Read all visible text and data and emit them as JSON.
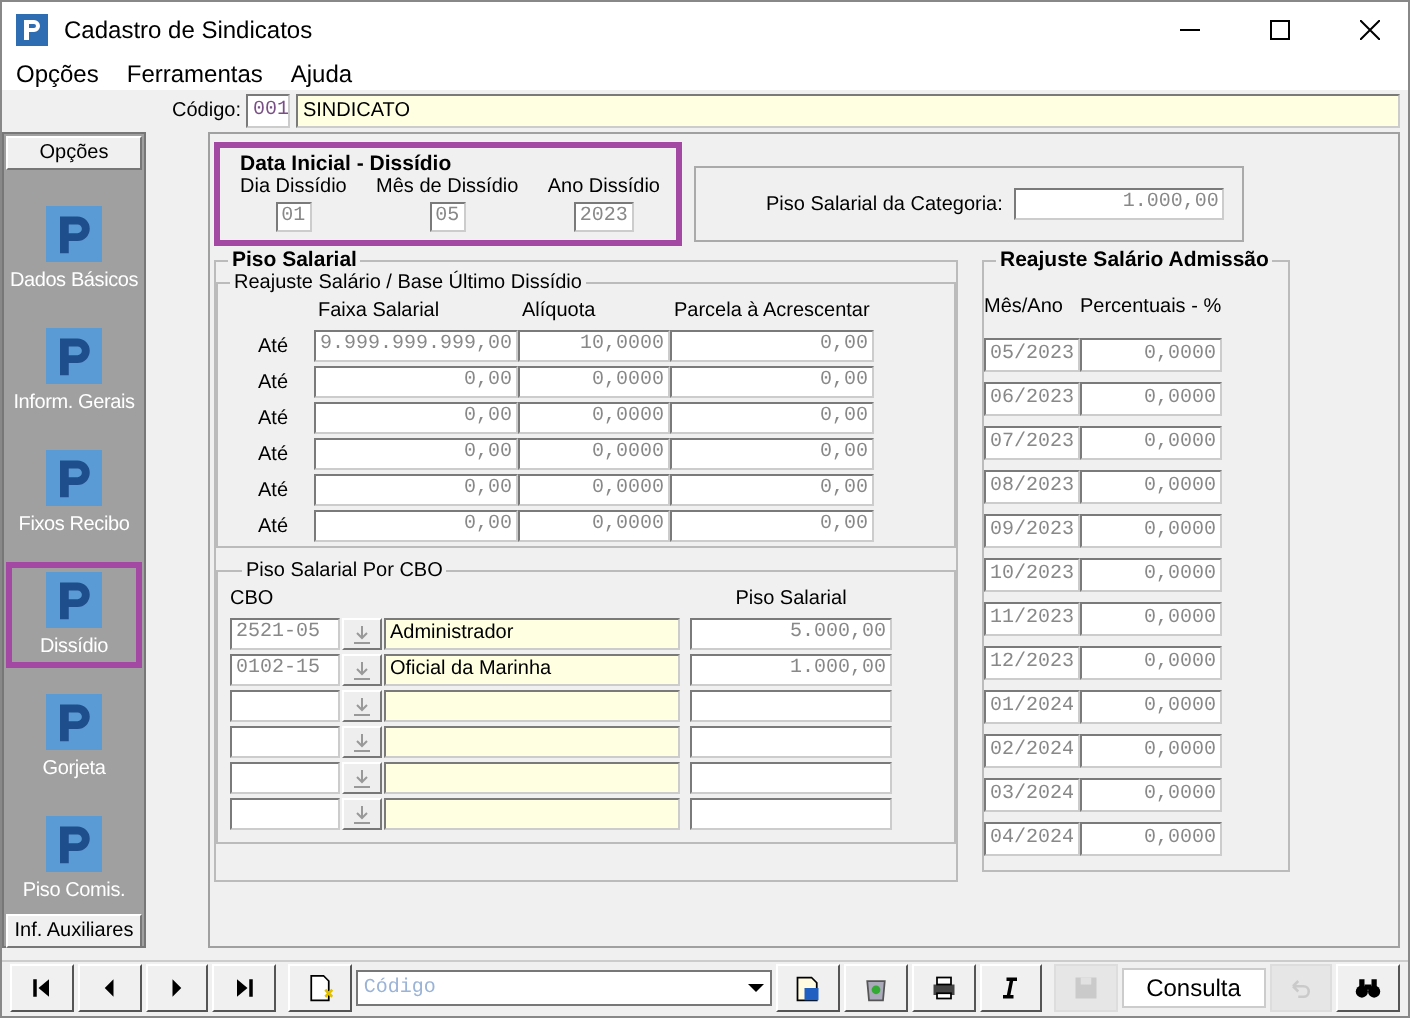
{
  "window": {
    "title": "Cadastro de Sindicatos"
  },
  "menu": [
    "Opções",
    "Ferramentas",
    "Ajuda"
  ],
  "code": {
    "label": "Código:",
    "number": "001",
    "name": "SINDICATO"
  },
  "sidebar": {
    "header": "Opções",
    "footer": "Inf. Auxiliares",
    "items": [
      {
        "label": "Dados Básicos",
        "selected": false
      },
      {
        "label": "Inform. Gerais",
        "selected": false
      },
      {
        "label": "Fixos Recibo",
        "selected": false
      },
      {
        "label": "Dissídio",
        "selected": true
      },
      {
        "label": "Gorjeta",
        "selected": false
      },
      {
        "label": "Piso Comis.",
        "selected": false
      }
    ]
  },
  "data_inicial": {
    "title": "Data Inicial - Dissídio",
    "highlighted": true,
    "fields": [
      {
        "label": "Dia Dissídio",
        "value": "01"
      },
      {
        "label": "Mês de Dissídio",
        "value": "05"
      },
      {
        "label": "Ano Dissídio",
        "value": "2023"
      }
    ]
  },
  "piso_categoria": {
    "label": "Piso Salarial da Categoria:",
    "value": "1.000,00"
  },
  "piso_salarial": {
    "title": "Piso Salarial",
    "reajuste": {
      "title": "Reajuste Salário / Base Último Dissídio",
      "columns": [
        "Faixa Salarial",
        "Alíquota",
        "Parcela à Acrescentar"
      ],
      "rows": [
        {
          "label": "Até",
          "faixa": "9.999.999.999,00",
          "aliquota": "10,0000",
          "parcela": "0,00"
        },
        {
          "label": "Até",
          "faixa": "0,00",
          "aliquota": "0,0000",
          "parcela": "0,00"
        },
        {
          "label": "Até",
          "faixa": "0,00",
          "aliquota": "0,0000",
          "parcela": "0,00"
        },
        {
          "label": "Até",
          "faixa": "0,00",
          "aliquota": "0,0000",
          "parcela": "0,00"
        },
        {
          "label": "Até",
          "faixa": "0,00",
          "aliquota": "0,0000",
          "parcela": "0,00"
        },
        {
          "label": "Até",
          "faixa": "0,00",
          "aliquota": "0,0000",
          "parcela": "0,00"
        }
      ]
    },
    "cbo": {
      "title": "Piso Salarial Por CBO",
      "columns": [
        "CBO",
        "Piso Salarial"
      ],
      "rows": [
        {
          "cbo": "2521-05",
          "descricao": "Administrador",
          "piso": "5.000,00"
        },
        {
          "cbo": "0102-15",
          "descricao": "Oficial da Marinha",
          "piso": "1.000,00"
        },
        {},
        {},
        {},
        {}
      ]
    }
  },
  "reajuste_admissao": {
    "title": "Reajuste Salário Admissão",
    "columns": [
      "Mês/Ano",
      "Percentuais - %"
    ],
    "rows": [
      {
        "month": "05/2023",
        "percent": "0,0000"
      },
      {
        "month": "06/2023",
        "percent": "0,0000"
      },
      {
        "month": "07/2023",
        "percent": "0,0000"
      },
      {
        "month": "08/2023",
        "percent": "0,0000"
      },
      {
        "month": "09/2023",
        "percent": "0,0000"
      },
      {
        "month": "10/2023",
        "percent": "0,0000"
      },
      {
        "month": "11/2023",
        "percent": "0,0000"
      },
      {
        "month": "12/2023",
        "percent": "0,0000"
      },
      {
        "month": "01/2024",
        "percent": "0,0000"
      },
      {
        "month": "02/2024",
        "percent": "0,0000"
      },
      {
        "month": "03/2024",
        "percent": "0,0000"
      },
      {
        "month": "04/2024",
        "percent": "0,0000"
      }
    ]
  },
  "toolbar": {
    "search_placeholder": "Código",
    "mode": "Consulta",
    "buttons": [
      {
        "kind": "first",
        "disabled": false
      },
      {
        "kind": "prev",
        "disabled": false
      },
      {
        "kind": "next",
        "disabled": false
      },
      {
        "kind": "last",
        "disabled": false
      },
      {
        "kind": "new",
        "disabled": false
      },
      {
        "kind": "search",
        "disabled": false
      },
      {
        "kind": "open",
        "disabled": false
      },
      {
        "kind": "delete",
        "disabled": false
      },
      {
        "kind": "print",
        "disabled": false
      },
      {
        "kind": "italic",
        "disabled": false
      },
      {
        "kind": "save",
        "disabled": true
      },
      {
        "kind": "mode",
        "disabled": false
      },
      {
        "kind": "undo",
        "disabled": true
      },
      {
        "kind": "find",
        "disabled": false
      }
    ]
  }
}
